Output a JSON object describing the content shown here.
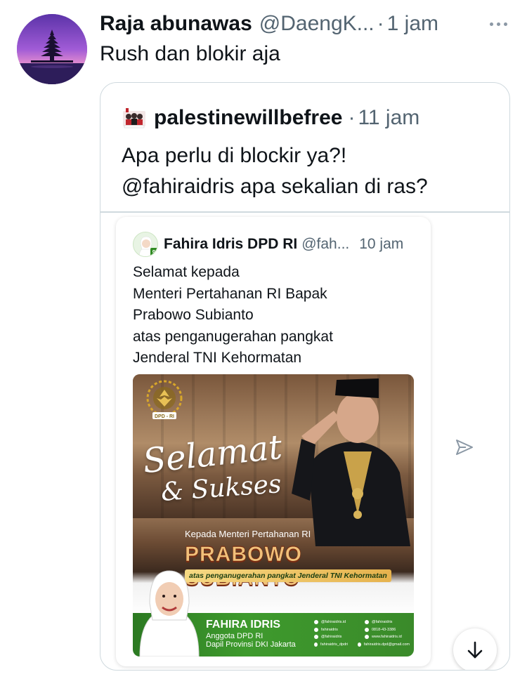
{
  "tweet": {
    "author_name": "Raja abunawas",
    "author_handle": "@DaengK...",
    "separator": "·",
    "time": "1 jam",
    "text": "Rush dan blokir aja",
    "more_icon": "more-horizontal-icon"
  },
  "quote": {
    "author_name": "palestinewillbefree",
    "separator": "·",
    "time": "11 jam",
    "text_lines": [
      "Apa perlu di blockir ya?!",
      "@fahiraidris apa sekalian di ras?"
    ]
  },
  "embedded": {
    "author_name": "Fahira Idris DPD RI",
    "author_handle": "@fah...",
    "time": "10 jam",
    "text_lines": [
      "Selamat kepada",
      "Menteri Pertahanan RI Bapak",
      "Prabowo Subianto",
      "atas penganugerahan pangkat",
      "Jenderal TNI Kehormatan"
    ],
    "banner": {
      "logo_text": "DPD - RI",
      "title_line1": "Selamat",
      "title_line2": "& Sukses",
      "kepada": "Kepada Menteri Pertahanan RI",
      "name": "PRABOWO SUBIANTO",
      "subtitle": "atas penganugerahan pangkat Jenderal TNI Kehormatan",
      "signer_name": "FAHIRA IDRIS",
      "signer_role1": "Anggota DPD RI",
      "signer_role2": "Dapil Provinsi DKI Jakarta",
      "contacts": [
        [
          "@fahiraidris.id",
          "@fahiraidris"
        ],
        [
          "fahiraidris",
          "0818-43-3386"
        ],
        [
          "@fahiraidris",
          "www.fahiraidris.id"
        ],
        [
          "fahiraidris_dpdri",
          "fahiraidris.dpd@gmail.com"
        ]
      ]
    }
  },
  "controls": {
    "share_icon": "share-icon",
    "scroll_icon": "arrow-down-icon"
  }
}
